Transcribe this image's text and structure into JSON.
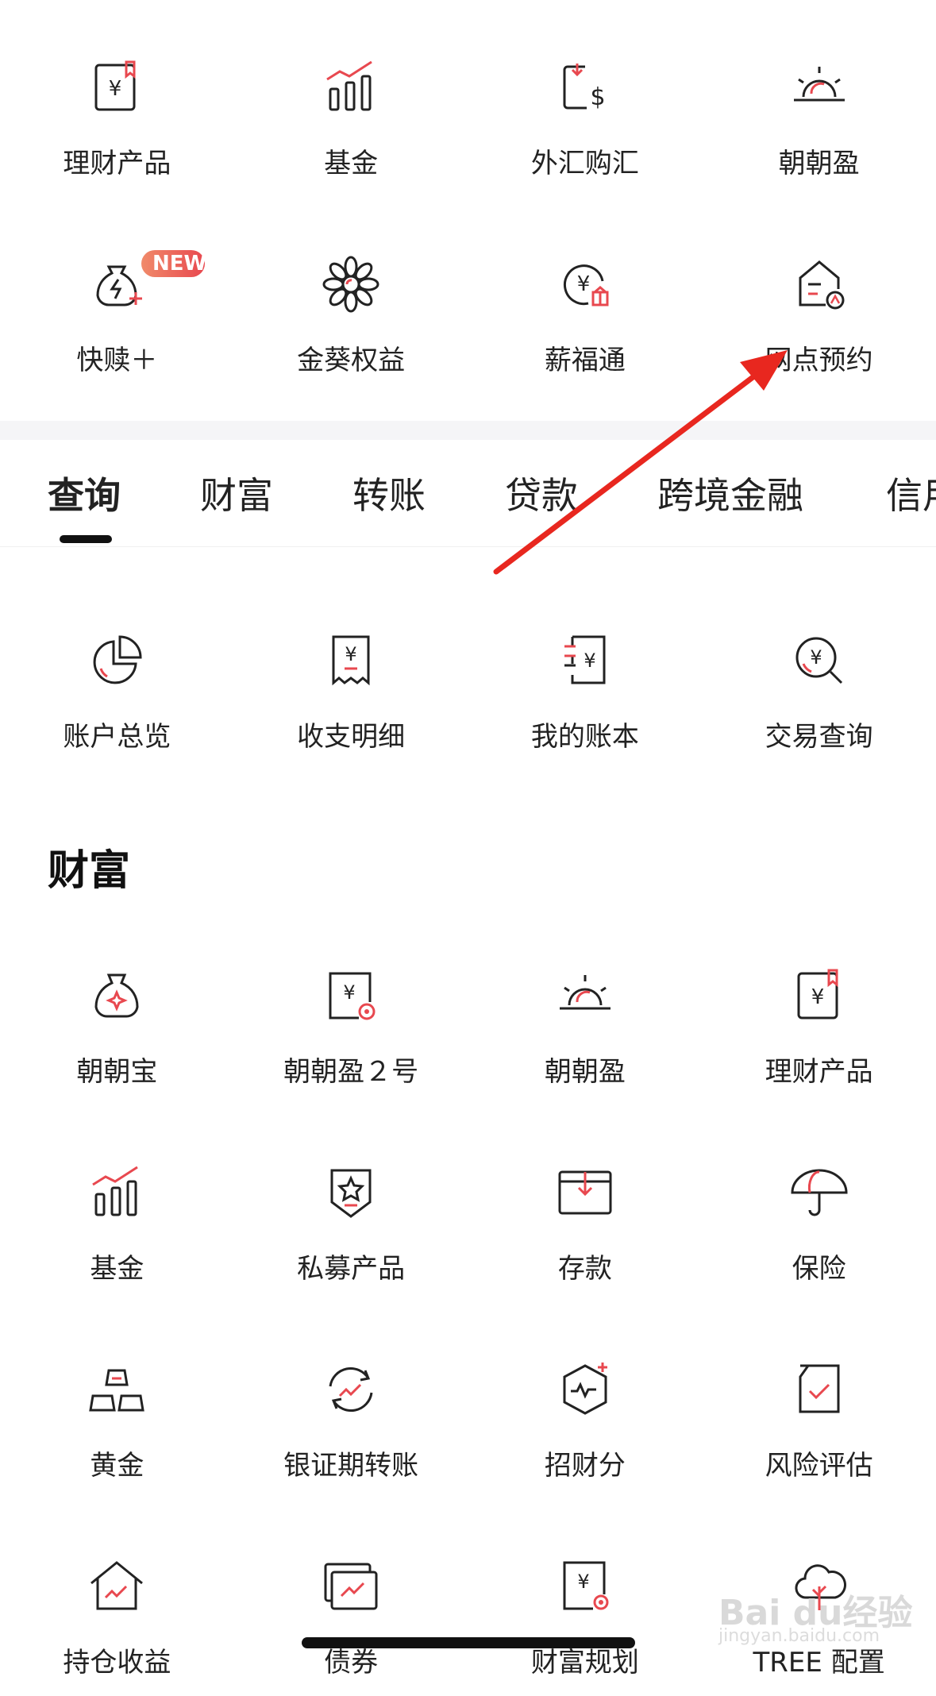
{
  "shortcuts": {
    "row1": [
      {
        "label": "理财产品",
        "icon": "wealth-product-icon"
      },
      {
        "label": "基金",
        "icon": "fund-chart-icon"
      },
      {
        "label": "外汇购汇",
        "icon": "forex-icon"
      },
      {
        "label": "朝朝盈",
        "icon": "sunrise-icon"
      }
    ],
    "row2": [
      {
        "label": "快赎＋",
        "icon": "quick-redeem-icon",
        "badge": "NEW"
      },
      {
        "label": "金葵权益",
        "icon": "sunflower-icon"
      },
      {
        "label": "薪福通",
        "icon": "salary-icon"
      },
      {
        "label": "网点预约",
        "icon": "branch-booking-icon"
      }
    ]
  },
  "tabs": [
    "查询",
    "财富",
    "转账",
    "贷款",
    "跨境金融",
    "信用"
  ],
  "active_tab": "查询",
  "query_items": [
    {
      "label": "账户总览",
      "icon": "pie-chart-icon"
    },
    {
      "label": "收支明细",
      "icon": "receipt-icon"
    },
    {
      "label": "我的账本",
      "icon": "ledger-icon"
    },
    {
      "label": "交易查询",
      "icon": "search-yuan-icon"
    }
  ],
  "wealth_section": {
    "title": "财富",
    "items": [
      {
        "label": "朝朝宝",
        "icon": "money-bag-icon"
      },
      {
        "label": "朝朝盈２号",
        "icon": "yuan-doc-icon"
      },
      {
        "label": "朝朝盈",
        "icon": "sunrise-icon"
      },
      {
        "label": "理财产品",
        "icon": "wealth-product-icon"
      },
      {
        "label": "基金",
        "icon": "fund-chart-icon"
      },
      {
        "label": "私募产品",
        "icon": "star-shield-icon"
      },
      {
        "label": "存款",
        "icon": "deposit-box-icon"
      },
      {
        "label": "保险",
        "icon": "umbrella-icon"
      },
      {
        "label": "黄金",
        "icon": "gold-bars-icon"
      },
      {
        "label": "银证期转账",
        "icon": "cycle-arrow-icon"
      },
      {
        "label": "招财分",
        "icon": "hexagon-pulse-icon"
      },
      {
        "label": "风险评估",
        "icon": "check-doc-icon"
      },
      {
        "label": "持仓收益",
        "icon": "house-chart-icon"
      },
      {
        "label": "债券",
        "icon": "bond-ticket-icon"
      },
      {
        "label": "财富规划",
        "icon": "planning-doc-icon"
      },
      {
        "label": "TREE 配置",
        "icon": "tree-icon"
      }
    ]
  },
  "watermark": {
    "main": "Bai du经验",
    "sub": "jingyan.baidu.com"
  },
  "colors": {
    "accent": "#e8484f",
    "text": "#222222",
    "arrow": "#e8271f"
  }
}
